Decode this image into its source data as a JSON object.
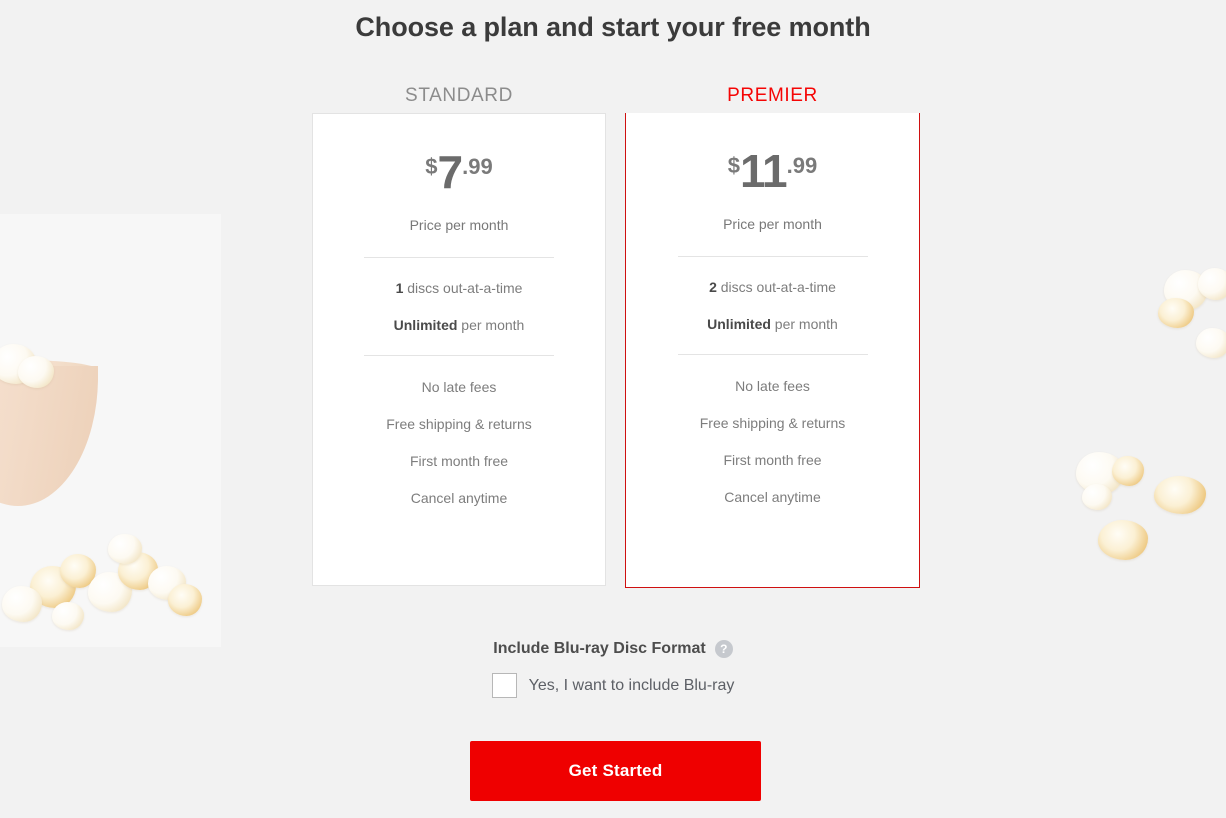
{
  "page": {
    "title": "Choose a plan and start your free month",
    "background_color": "#f2f2f2"
  },
  "plans": [
    {
      "id": "standard",
      "label": "STANDARD",
      "label_color": "#8c8c8c",
      "highlighted": false,
      "price": {
        "currency": "$",
        "whole": "7",
        "decimal": ".99",
        "caption": "Price per month"
      },
      "specs": [
        {
          "value": "1",
          "text": " discs out-at-a-time"
        },
        {
          "value": "Unlimited",
          "text": " per month"
        }
      ],
      "perks": [
        "No late fees",
        "Free shipping & returns",
        "First month free",
        "Cancel anytime"
      ]
    },
    {
      "id": "premier",
      "label": "PREMIER",
      "label_color": "#f50505",
      "highlighted": true,
      "accent_color": "#ed0000",
      "price": {
        "currency": "$",
        "whole": "11",
        "decimal": ".99",
        "caption": "Price per month"
      },
      "specs": [
        {
          "value": "2",
          "text": " discs out-at-a-time"
        },
        {
          "value": "Unlimited",
          "text": " per month"
        }
      ],
      "perks": [
        "No late fees",
        "Free shipping & returns",
        "First month free",
        "Cancel anytime"
      ]
    }
  ],
  "bluray": {
    "title": "Include Blu-ray Disc Format",
    "help_icon": "?",
    "checkbox_label": "Yes, I want to include Blu-ray",
    "checked": false
  },
  "cta": {
    "label": "Get Started",
    "color": "#ef0000"
  }
}
